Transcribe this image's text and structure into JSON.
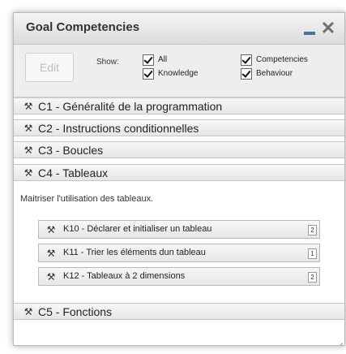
{
  "window": {
    "title": "Goal Competencies",
    "close_glyph": "✕"
  },
  "toolbar": {
    "edit_label": "Edit",
    "show_label": "Show:",
    "filters": [
      {
        "label": "All",
        "checked": true
      },
      {
        "label": "Knowledge",
        "checked": true
      },
      {
        "label": "Competencies",
        "checked": true
      },
      {
        "label": "Behaviour",
        "checked": true
      }
    ]
  },
  "competencies": [
    {
      "label": "C1 - Généralité de la programmation",
      "icon": "wrench-icon"
    },
    {
      "label": "C2 - Instructions conditionnelles",
      "icon": "wrench-icon"
    },
    {
      "label": "C3 - Boucles",
      "icon": "wrench-icon"
    },
    {
      "label": "C4 - Tableaux",
      "icon": "wrench-icon"
    },
    {
      "label": "C5 - Fonctions",
      "icon": "wrench-icon"
    }
  ],
  "expanded": {
    "description": "Maitriser l'utilisation des tableaux.",
    "knowledge": [
      {
        "label": "K10 - Déclarer et initialiser un tableau",
        "level": "2",
        "icon": "wrench-icon"
      },
      {
        "label": "K11 - Trier les éléments dun tableau",
        "level": "1",
        "icon": "wrench-icon"
      },
      {
        "label": "K12 - Tableaux à 2 dimensions",
        "level": "2",
        "icon": "wrench-icon"
      }
    ]
  },
  "icon_glyph": "⚒"
}
